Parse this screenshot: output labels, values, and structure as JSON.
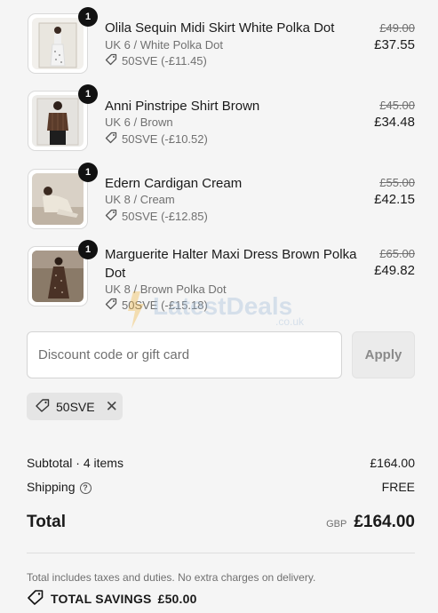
{
  "line_items": [
    {
      "title": "Olila Sequin Midi Skirt White Polka Dot",
      "variant": "UK 6 / White Polka Dot",
      "discount": "50SVE (-£11.45)",
      "original_price": "£49.00",
      "price": "£37.55",
      "quantity": "1"
    },
    {
      "title": "Anni Pinstripe Shirt Brown",
      "variant": "UK 6 / Brown",
      "discount": "50SVE (-£10.52)",
      "original_price": "£45.00",
      "price": "£34.48",
      "quantity": "1"
    },
    {
      "title": "Edern Cardigan Cream",
      "variant": "UK 8 / Cream",
      "discount": "50SVE (-£12.85)",
      "original_price": "£55.00",
      "price": "£42.15",
      "quantity": "1"
    },
    {
      "title": "Marguerite Halter Maxi Dress Brown Polka Dot",
      "variant": "UK 8 / Brown Polka Dot",
      "discount": "50SVE (-£15.18)",
      "original_price": "£65.00",
      "price": "£49.82",
      "quantity": "1"
    }
  ],
  "discount_form": {
    "placeholder": "Discount code or gift card",
    "apply_label": "Apply"
  },
  "applied_code": "50SVE",
  "summary": {
    "subtotal_label": "Subtotal · 4 items",
    "subtotal_value": "£164.00",
    "shipping_label": "Shipping",
    "shipping_value": "FREE",
    "total_label": "Total",
    "currency": "GBP",
    "total_value": "£164.00",
    "tax_note": "Total includes taxes and duties. No extra charges on delivery.",
    "savings_label": "TOTAL SAVINGS",
    "savings_value": "£50.00"
  },
  "watermark": {
    "text": "LatestDeals",
    "suffix": ".co.uk"
  },
  "colors": {
    "background": "#f5f5f5",
    "badge": "#111111",
    "muted_text": "#707070"
  }
}
